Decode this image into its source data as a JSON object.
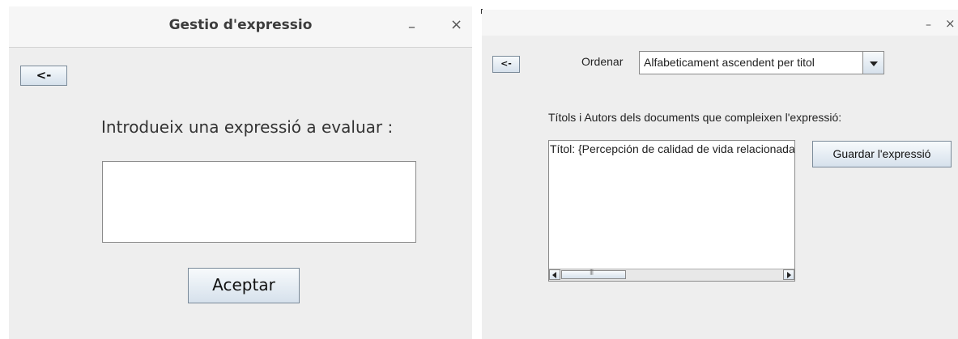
{
  "left_window": {
    "title": "Gestio d'expressio",
    "minimize_glyph": "–",
    "close_glyph": "×",
    "back_label": "<-",
    "prompt": "Introdueix una expressió a evaluar :",
    "expression_value": "",
    "accept_label": "Aceptar"
  },
  "right_window": {
    "minimize_glyph": "–",
    "close_glyph": "×",
    "back_label": "<-",
    "order_label": "Ordenar",
    "order_selected": "Alfabeticament ascendent per titol",
    "results_label": "Títols i  Autors dels documents que compleixen l'expressió:",
    "results_text": "Títol: {Percepción de calidad de vida relacionada con la salud",
    "save_label": "Guardar l'expressió"
  }
}
